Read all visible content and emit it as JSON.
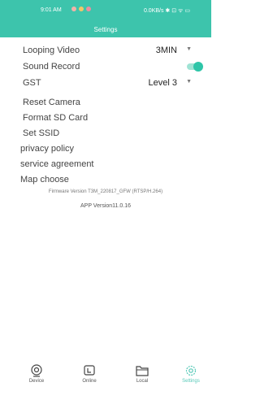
{
  "status_bar": {
    "time": "9:01 AM",
    "right_text": "0.0KB/s ✱ ⊡ ᯤ ▭"
  },
  "header": {
    "title": "Settings"
  },
  "settings": {
    "looping_video": {
      "label": "Looping Video",
      "value": "3MIN"
    },
    "sound_record": {
      "label": "Sound Record",
      "enabled": true
    },
    "gst": {
      "label": "GST",
      "value": "Level 3"
    },
    "reset_camera": "Reset Camera",
    "format_sd": "Format SD Card",
    "set_ssid": "Set SSID",
    "privacy_policy": "privacy policy",
    "service_agreement": "service agreement",
    "map_choose": "Map choose"
  },
  "info": {
    "firmware": "Firmware Version  T3M_220817_GFW (RTSP/H.264)",
    "app_version": "APP Version11.0.16"
  },
  "tabs": [
    {
      "label": "Device",
      "icon": "camera-icon",
      "active": false
    },
    {
      "label": "Online",
      "icon": "video-icon",
      "active": false
    },
    {
      "label": "Local",
      "icon": "folder-icon",
      "active": false
    },
    {
      "label": "Settings",
      "icon": "gear-icon",
      "active": true
    }
  ],
  "colors": {
    "header": "#3dc4ac",
    "accent": "#2ec5a8"
  }
}
